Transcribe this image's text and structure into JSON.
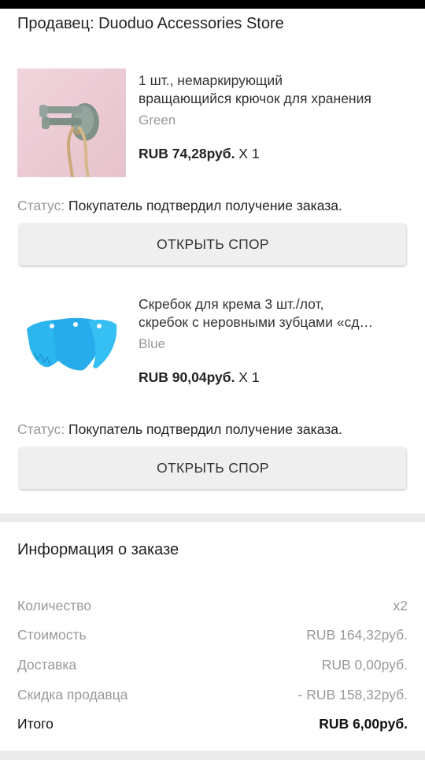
{
  "seller": {
    "label": "Продавец: Duoduo Accessories Store"
  },
  "items": [
    {
      "title_line1": "1 шт., немаркирующий",
      "title_line2": "вращающийся крючок для хранения",
      "variant": "Green",
      "price": "RUB 74,28руб.",
      "qty": " X 1",
      "status_label": "Статус:",
      "status_value": " Покупатель подтвердил получение заказа.",
      "button_label": "ОТКРЫТЬ СПОР",
      "image_icon": "swivel-hook-image"
    },
    {
      "title_line1": "Скребок для крема 3 шт./лот,",
      "title_line2": "скребок с неровными зубцами «сд…",
      "variant": "Blue",
      "price": "RUB 90,04руб.",
      "qty": " X 1",
      "status_label": "Статус:",
      "status_value": " Покупатель подтвердил получение заказа.",
      "button_label": "ОТКРЫТЬ СПОР",
      "image_icon": "cream-scraper-image"
    }
  ],
  "order_info": {
    "title": "Информация о заказе",
    "rows": [
      {
        "label": "Количество",
        "value": "x2"
      },
      {
        "label": "Стоимость",
        "value": "RUB 164,32руб."
      },
      {
        "label": "Доставка",
        "value": "RUB 0,00руб."
      },
      {
        "label": "Скидка продавца",
        "value": "- RUB 158,32руб."
      }
    ],
    "total": {
      "label": "Итого",
      "value": "RUB 6,00руб."
    }
  },
  "colors": {
    "status_bar": "#000000",
    "muted_text": "#999999",
    "button_bg": "#efefef",
    "divider": "#ebebeb",
    "scraper_blue": "#2bb6ef",
    "hook_bg_pink": "#efd0d8"
  }
}
